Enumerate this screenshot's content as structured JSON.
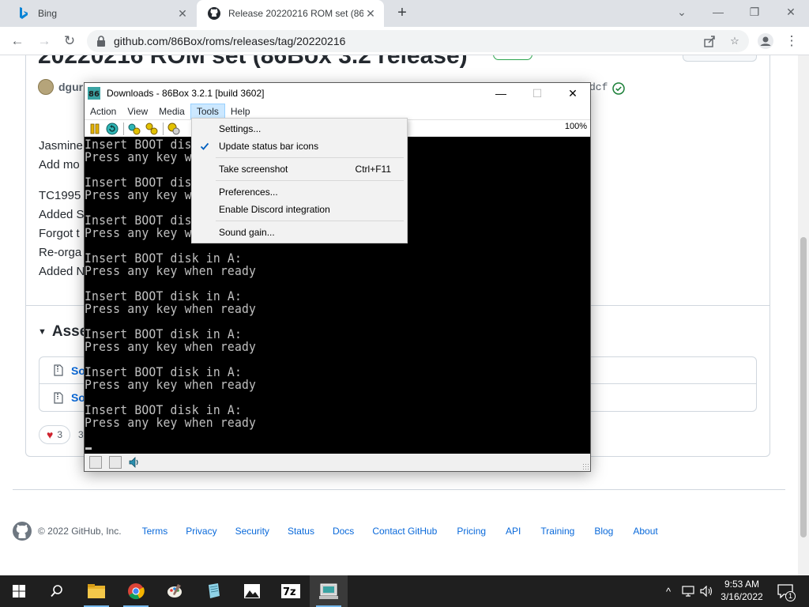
{
  "browser": {
    "tabs": [
      {
        "title": "Bing",
        "icon": "bing-icon"
      },
      {
        "title": "Release 20220216 ROM set (86B",
        "icon": "github-icon",
        "active": true
      }
    ],
    "url": "github.com/86Box/roms/releases/tag/20220216"
  },
  "page": {
    "title": "20220216 ROM set (86Box 3.2 release)",
    "author": "dgurney",
    "commit_sha": "dcf",
    "body_lines": [
      "Jasmine",
      "Add mo",
      "TC1995",
      "Added S",
      "Forgot t",
      "Re-orga",
      "Added N"
    ],
    "assets_heading": "Asse",
    "assets": [
      {
        "name": "So"
      },
      {
        "name": "So"
      }
    ],
    "reaction_count": "3",
    "reaction_people": "3",
    "footer": {
      "copyright": "© 2022 GitHub, Inc.",
      "links": [
        "Terms",
        "Privacy",
        "Security",
        "Status",
        "Docs",
        "Contact GitHub",
        "Pricing",
        "API",
        "Training",
        "Blog",
        "About"
      ]
    }
  },
  "emulator": {
    "window_title": "Downloads - 86Box 3.2.1 [build 3602]",
    "menu": [
      "Action",
      "View",
      "Media",
      "Tools",
      "Help"
    ],
    "open_menu": "Tools",
    "zoom": "100%",
    "screen_lines": [
      "Insert BOOT disk in A:",
      "Press any key when ready",
      "",
      "Insert BOOT disk in A:",
      "Press any key when ready",
      "",
      "Insert BOOT disk in A:",
      "Press any key when ready",
      "",
      "Insert BOOT disk in A:",
      "Press any key when ready",
      "",
      "Insert BOOT disk in A:",
      "Press any key when ready",
      "",
      "Insert BOOT disk in A:",
      "Press any key when ready",
      "",
      "Insert BOOT disk in A:",
      "Press any key when ready",
      "",
      "Insert BOOT disk in A:",
      "Press any key when ready"
    ],
    "tools_menu": [
      {
        "label": "Settings...",
        "shortcut": "",
        "checked": false
      },
      {
        "label": "Update status bar icons",
        "shortcut": "",
        "checked": true
      },
      {
        "label": "Take screenshot",
        "shortcut": "Ctrl+F11",
        "checked": false
      },
      {
        "label": "Preferences...",
        "shortcut": "",
        "checked": false
      },
      {
        "label": "Enable Discord integration",
        "shortcut": "",
        "checked": false
      },
      {
        "label": "Sound gain...",
        "shortcut": "",
        "checked": false
      }
    ]
  },
  "taskbar": {
    "apps": [
      "file-explorer-icon",
      "chrome-icon",
      "paint-icon",
      "notepad-icon",
      "photos-icon",
      "7zip-icon",
      "86box-icon"
    ],
    "time": "9:53 AM",
    "date": "3/16/2022",
    "notifications": "1"
  },
  "colors": {
    "link": "#0969da",
    "menu_highlight": "#cce8ff",
    "taskbar": "#1f1f1f"
  }
}
